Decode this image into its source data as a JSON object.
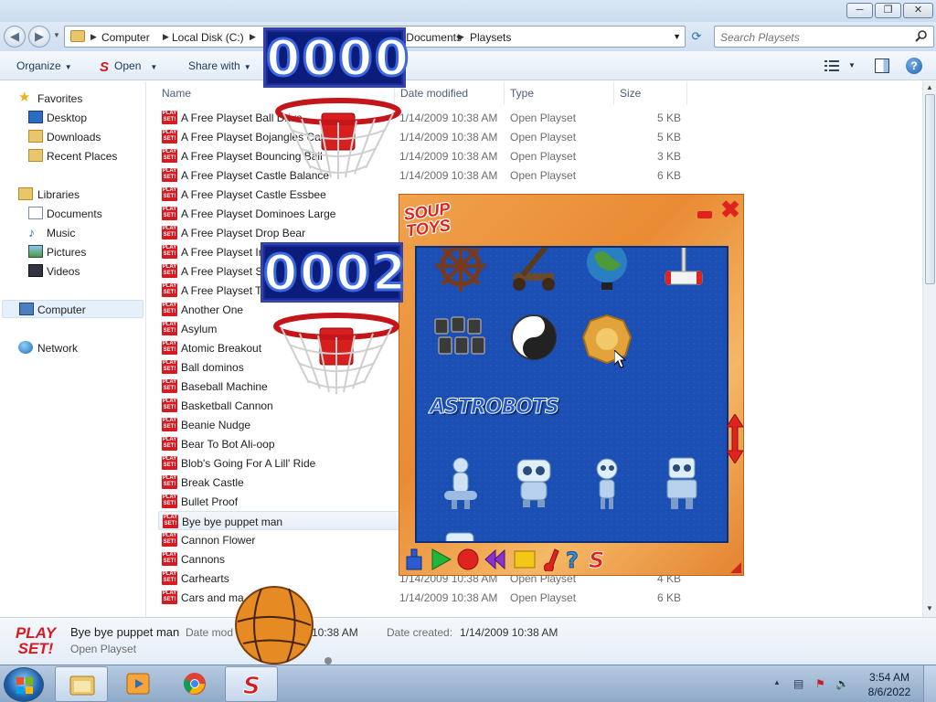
{
  "window": {
    "minimize": "─",
    "maximize": "❐",
    "close": "✕"
  },
  "address": {
    "crumbs": [
      "Computer",
      "Local Disk (C:)",
      "Documents",
      "Playsets"
    ],
    "search_placeholder": "Search Playsets"
  },
  "toolbar": {
    "organize": "Organize",
    "open": "Open",
    "share_with": "Share with"
  },
  "nav": {
    "favorites": "Favorites",
    "desktop": "Desktop",
    "downloads": "Downloads",
    "recent_places": "Recent Places",
    "libraries": "Libraries",
    "documents": "Documents",
    "music": "Music",
    "pictures": "Pictures",
    "videos": "Videos",
    "computer": "Computer",
    "network": "Network"
  },
  "columns": {
    "name": "Name",
    "date_modified": "Date modified",
    "type": "Type",
    "size": "Size"
  },
  "file_icon_text": "PLAY SET!",
  "files": [
    {
      "name": "A Free Playset Ball Drive",
      "date": "1/14/2009 10:38 AM",
      "type": "Open Playset",
      "size": "5 KB"
    },
    {
      "name": "A Free Playset Bojangles Castle",
      "date": "1/14/2009 10:38 AM",
      "type": "Open Playset",
      "size": "5 KB"
    },
    {
      "name": "A Free Playset Bouncing Ball",
      "date": "1/14/2009 10:38 AM",
      "type": "Open Playset",
      "size": "3 KB"
    },
    {
      "name": "A Free Playset Castle Balance",
      "date": "1/14/2009 10:38 AM",
      "type": "Open Playset",
      "size": "6 KB"
    },
    {
      "name": "A Free Playset Castle Essbee",
      "date": "",
      "type": "",
      "size": ""
    },
    {
      "name": "A Free Playset Dominoes Large",
      "date": "",
      "type": "",
      "size": ""
    },
    {
      "name": "A Free Playset Drop Bear",
      "date": "",
      "type": "",
      "size": ""
    },
    {
      "name": "A Free Playset Im",
      "date": "",
      "type": "",
      "size": ""
    },
    {
      "name": "A Free Playset Sk",
      "date": "",
      "type": "",
      "size": ""
    },
    {
      "name": "A Free Playset Te",
      "date": "",
      "type": "",
      "size": ""
    },
    {
      "name": "Another One",
      "date": "",
      "type": "",
      "size": ""
    },
    {
      "name": "Asylum",
      "date": "",
      "type": "",
      "size": ""
    },
    {
      "name": "Atomic Breakout",
      "date": "",
      "type": "",
      "size": ""
    },
    {
      "name": "Ball dominos",
      "date": "",
      "type": "",
      "size": ""
    },
    {
      "name": "Baseball Machine",
      "date": "",
      "type": "",
      "size": ""
    },
    {
      "name": "Basketball Cannon",
      "date": "",
      "type": "",
      "size": ""
    },
    {
      "name": "Beanie Nudge",
      "date": "",
      "type": "",
      "size": ""
    },
    {
      "name": "Bear To Bot Ali-oop",
      "date": "",
      "type": "",
      "size": ""
    },
    {
      "name": "Blob's Going For A Lill' Ride",
      "date": "",
      "type": "",
      "size": ""
    },
    {
      "name": "Break Castle",
      "date": "",
      "type": "",
      "size": ""
    },
    {
      "name": "Bullet Proof",
      "date": "",
      "type": "",
      "size": ""
    },
    {
      "name": "Bye bye puppet man",
      "date": "",
      "type": "",
      "size": "",
      "selected": true
    },
    {
      "name": "Cannon Flower",
      "date": "",
      "type": "",
      "size": ""
    },
    {
      "name": "Cannons",
      "date": "",
      "type": "",
      "size": ""
    },
    {
      "name": "Carhearts",
      "date": "1/14/2009 10:38 AM",
      "type": "Open Playset",
      "size": "4 KB"
    },
    {
      "name": "Cars and ma",
      "date": "1/14/2009 10:38 AM",
      "type": "Open Playset",
      "size": "6 KB"
    }
  ],
  "details": {
    "logo": "PLAY SET!",
    "name": "Bye bye puppet man",
    "type": "Open Playset",
    "modified_label": "Date mod",
    "modified_value": "10:38 AM",
    "created_label": "Date created:",
    "created_value": "1/14/2009 10:38 AM"
  },
  "scores": {
    "top": "0000",
    "bottom": "0002"
  },
  "palette": {
    "logo": "SOUP TOYS",
    "category": "ASTROBOTS",
    "toys": [
      "ship-wheel",
      "catapult",
      "globe",
      "mallet",
      "buckets",
      "yin-yang",
      "gold-coin",
      "robot-1",
      "robot-2",
      "robot-3",
      "robot-4"
    ],
    "toolbar": [
      "blue-block",
      "play",
      "record",
      "rewind",
      "yellow-square",
      "music-note",
      "help",
      "soup-logo"
    ]
  },
  "taskbar": {
    "time": "3:54 AM",
    "date": "8/6/2022"
  },
  "colors": {
    "accent_red": "#d71920",
    "grid_blue": "#1b4fb4",
    "palette_orange": "#e98b34",
    "score_blue": "#0c1c7a"
  }
}
